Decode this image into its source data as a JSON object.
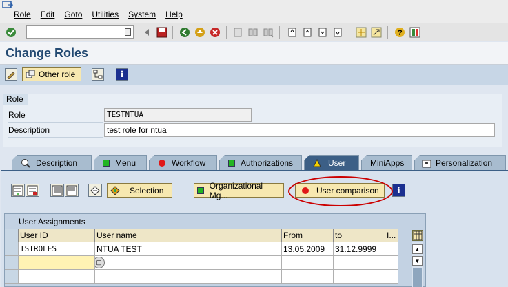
{
  "menu": {
    "items": [
      "Role",
      "Edit",
      "Goto",
      "Utilities",
      "System",
      "Help"
    ]
  },
  "toolbar": {
    "command_value": ""
  },
  "title": "Change Roles",
  "app_toolbar": {
    "other_role_label": "Other role"
  },
  "role_group": {
    "title": "Role",
    "role_label": "Role",
    "role_value": "TESTNTUA",
    "description_label": "Description",
    "description_value": "test role for ntua"
  },
  "tabs": [
    {
      "label": "Description",
      "icon": "magnifier-icon"
    },
    {
      "label": "Menu",
      "icon": "green-status-icon"
    },
    {
      "label": "Workflow",
      "icon": "red-status-icon"
    },
    {
      "label": "Authorizations",
      "icon": "green-status-icon"
    },
    {
      "label": "User",
      "icon": "yellow-warning-icon",
      "active": true
    },
    {
      "label": "MiniApps",
      "icon": ""
    },
    {
      "label": "Personalization",
      "icon": "personalization-icon"
    }
  ],
  "user_tab": {
    "selection_label": "Selection",
    "org_mgmt_label": "Organizational Mg...",
    "user_comparison_label": "User comparison"
  },
  "table": {
    "title": "User Assignments",
    "columns": [
      "User ID",
      "User name",
      "From",
      "to",
      "I..."
    ],
    "rows": [
      {
        "user_id": "TSTROLES",
        "user_name": "NTUA TEST",
        "from": "13.05.2009",
        "to": "31.12.9999"
      }
    ]
  },
  "colors": {
    "title": "#244a72",
    "tab_active": "#3c5f86",
    "button_bg": "#f7e8b0",
    "highlight": "#cc0000"
  }
}
